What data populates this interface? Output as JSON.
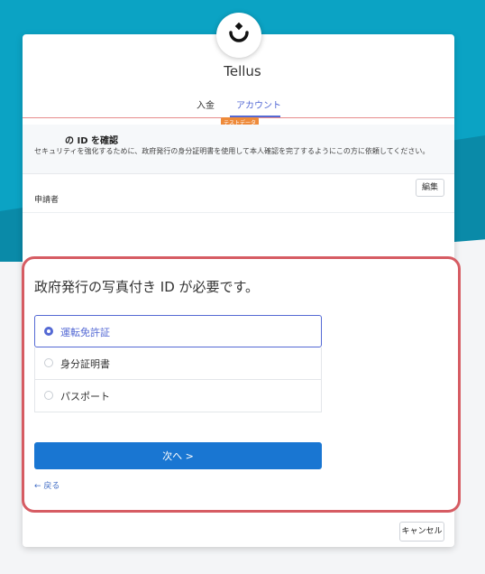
{
  "app": {
    "title": "Tellus"
  },
  "tabs": [
    {
      "label": "入金",
      "active": false
    },
    {
      "label": "アカウント",
      "active": true
    }
  ],
  "badge": {
    "label": "テストデータ"
  },
  "confirm": {
    "title": "の ID を確認",
    "description": "セキュリティを強化するために、政府発行の身分証明書を使用して本人確認を完了するようにこの方に依頼してください。"
  },
  "applicant": {
    "label": "申請者",
    "edit_label": "編集"
  },
  "id_form": {
    "heading": "政府発行の写真付き ID が必要です。",
    "options": [
      {
        "label": "運転免許証",
        "selected": true
      },
      {
        "label": "身分証明書",
        "selected": false
      },
      {
        "label": "パスポート",
        "selected": false
      }
    ],
    "next_label": "次へ  >",
    "back_label": "戻る"
  },
  "footer": {
    "cancel_label": "キャンセル"
  },
  "colors": {
    "accent": "#5469d4",
    "primary_button": "#1976d2",
    "highlight_border": "#d65c63",
    "teal_bg": "#0ba3c4"
  }
}
